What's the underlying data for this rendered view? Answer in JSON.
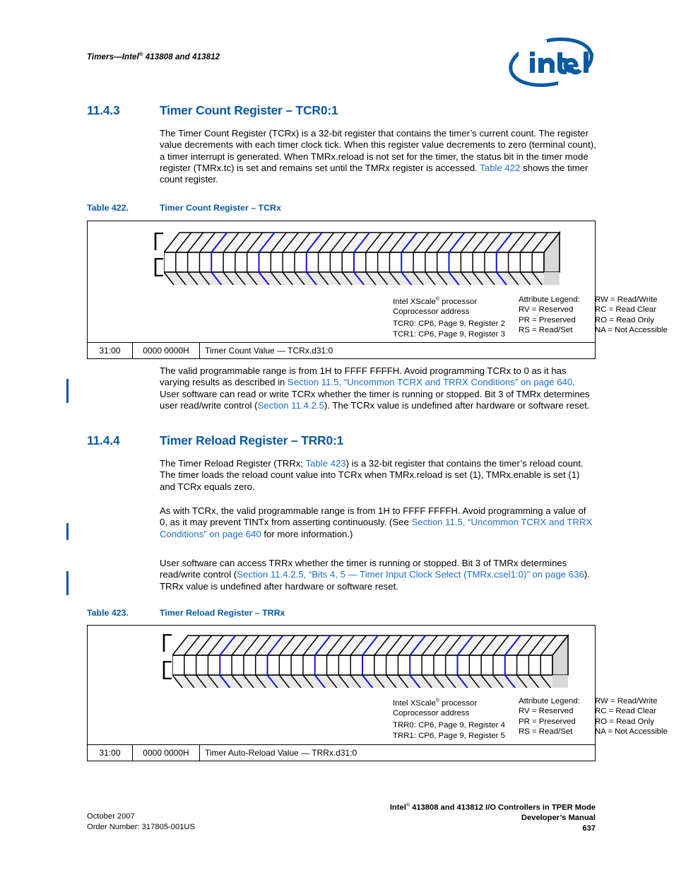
{
  "header": {
    "running_head_prefix": "Timers—Intel",
    "running_head_reg": "®",
    "running_head_suffix": " 413808 and 413812",
    "logo_wordmark": "intel",
    "brand_color": "#0a5aa0"
  },
  "sections": [
    {
      "number": "11.4.3",
      "title": "Timer Count Register – TCR0:1",
      "paragraphs": [
        {
          "runs": [
            {
              "text": "The Timer Count Register (TCRx) is a 32-bit register that contains the timer’s current count. The register value decrements with each timer clock tick. When this register value decrements to zero (terminal count), a timer interrupt is generated. When TMRx.reload is not set for the timer, the status bit in the timer mode register (TMRx.tc) is set and remains set until the TMRx register is accessed. ",
              "link": false
            },
            {
              "text": "Table 422",
              "link": true
            },
            {
              "text": " shows the timer count register.",
              "link": false
            }
          ]
        }
      ]
    },
    {
      "number": "11.4.4",
      "title": "Timer Reload Register – TRR0:1",
      "paragraphs": [
        {
          "runs": [
            {
              "text": "The Timer Reload Register (TRRx; ",
              "link": false
            },
            {
              "text": "Table 423",
              "link": true
            },
            {
              "text": ") is a 32-bit register that contains the timer’s reload count. The timer loads the reload count value into TCRx when TMRx.reload is set (1), TMRx.enable is set (1) and TCRx equals zero.",
              "link": false
            }
          ]
        },
        {
          "runs": [
            {
              "text": "As with TCRx, the valid programmable range is from 1H to FFFF FFFFH. Avoid programming a value of 0, as it may prevent TINTx from asserting continuously. (See ",
              "link": false
            },
            {
              "text": "Section 11.5, “Uncommon TCRX and TRRX Conditions” on page 640",
              "link": true
            },
            {
              "text": " for more information.)",
              "link": false
            }
          ]
        },
        {
          "runs": [
            {
              "text": "User software can access TRRx whether the timer is running or stopped. Bit 3 of TMRx determines read/write control (",
              "link": false
            },
            {
              "text": "Section 11.4.2.5, “Bits 4, 5 — Timer Input Clock Select (TMRx.csel1:0)” on page 636",
              "link": true
            },
            {
              "text": "). TRRx value is undefined after hardware or software reset.",
              "link": false
            }
          ]
        }
      ]
    }
  ],
  "post_table_paragraph": {
    "runs": [
      {
        "text": "The valid programmable range is from 1H to FFFF FFFFH. Avoid programming TCRx to 0 as it has varying results as described in ",
        "link": false
      },
      {
        "text": "Section 11.5, “Uncommon TCRX and TRRX Conditions” on page 640",
        "link": true
      },
      {
        "text": ". User software can read or write TCRx whether the timer is running or stopped. Bit 3 of TMRx determines user read/write control (",
        "link": false
      },
      {
        "text": "Section 11.4.2.5",
        "link": true
      },
      {
        "text": "). The TCRx value is undefined after hardware or software reset.",
        "link": false
      }
    ]
  },
  "tables": [
    {
      "caption_number": "Table 422.",
      "caption_title": "Timer Count Register – TCRx",
      "bit_count": 32,
      "legend": {
        "processor_line1": "Intel XScale",
        "processor_reg": "®",
        "processor_line1_suffix": " processor",
        "processor_line2": "Coprocessor address",
        "address_line1": "TCR0: CP6, Page 9, Register 2",
        "address_line2": "TCR1: CP6, Page 9, Register 3",
        "attribute_header": "Attribute Legend:",
        "attributes_left": [
          "RV = Reserved",
          "PR = Preserved",
          "RS = Read/Set"
        ],
        "attributes_right": [
          "RW = Read/Write",
          "RC = Read Clear",
          "RO = Read Only",
          "NA = Not Accessible"
        ]
      },
      "row": {
        "bits": "31:00",
        "reset_value": "0000 0000H",
        "description": "Timer Count Value — TCRx.d31:0"
      }
    },
    {
      "caption_number": "Table 423.",
      "caption_title": "Timer Reload Register – TRRx",
      "bit_count": 32,
      "legend": {
        "processor_line1": "Intel XScale",
        "processor_reg": "®",
        "processor_line1_suffix": " processor",
        "processor_line2": "Coprocessor address",
        "address_line1": "TRR0: CP6, Page 9, Register 4",
        "address_line2": "TRR1: CP6, Page 9, Register 5",
        "attribute_header": "Attribute Legend:",
        "attributes_left": [
          "RV = Reserved",
          "PR = Preserved",
          "RS = Read/Set"
        ],
        "attributes_right": [
          "RW = Read/Write",
          "RC = Read Clear",
          "RO = Read Only",
          "NA = Not Accessible"
        ]
      },
      "row": {
        "bits": "31:00",
        "reset_value": "0000 0000H",
        "description": "Timer Auto-Reload Value — TRRx.d31:0"
      }
    }
  ],
  "footer": {
    "left_line1": "October 2007",
    "left_line2": "Order Number: 317805-001US",
    "right_line1_prefix": "Intel",
    "right_line1_reg": "®",
    "right_line1_suffix": " 413808 and 413812 I/O Controllers in TPER Mode",
    "right_line2": "Developer’s Manual",
    "page_number": "637"
  }
}
